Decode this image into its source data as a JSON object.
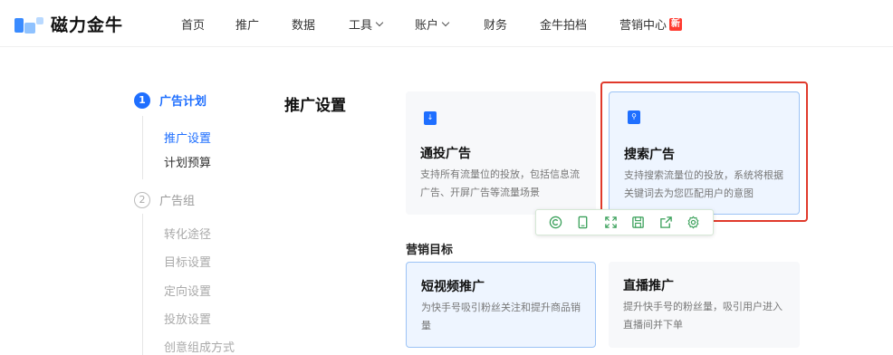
{
  "brand": {
    "name": "磁力金牛"
  },
  "nav": {
    "items": [
      {
        "label": "首页",
        "dropdown": false
      },
      {
        "label": "推广",
        "dropdown": false
      },
      {
        "label": "数据",
        "dropdown": false
      },
      {
        "label": "工具",
        "dropdown": true
      },
      {
        "label": "账户",
        "dropdown": true
      },
      {
        "label": "财务",
        "dropdown": false
      },
      {
        "label": "金牛拍档",
        "dropdown": false
      },
      {
        "label": "营销中心",
        "dropdown": false,
        "badge": "新"
      }
    ]
  },
  "steps": {
    "step1": {
      "num": "1",
      "title": "广告计划",
      "subs": [
        "推广设置",
        "计划预算"
      ]
    },
    "step2": {
      "num": "2",
      "title": "广告组",
      "subs": [
        "转化途径",
        "目标设置",
        "定向设置",
        "投放设置",
        "创意组成方式"
      ]
    }
  },
  "main": {
    "section_title": "推广设置",
    "cards": [
      {
        "title": "通投广告",
        "desc": "支持所有流量位的投放，包括信息流广告、开屏广告等流量场景",
        "icon": "download-icon",
        "selected": false
      },
      {
        "title": "搜索广告",
        "desc": "支持搜索流量位的投放，系统将根据关键词去为您匹配用户的意图",
        "icon": "search-doc-icon",
        "selected": true
      }
    ],
    "goal_title": "营销目标",
    "goal_cards": [
      {
        "title": "短视频推广",
        "desc": "为快手号吸引粉丝关注和提升商品销量",
        "selected": true
      },
      {
        "title": "直播推广",
        "desc": "提升快手号的粉丝量，吸引用户进入直播间并下单",
        "selected": false
      }
    ]
  },
  "toolbar": {
    "icons": [
      "copyright-icon",
      "phone-icon",
      "expand-icon",
      "save-icon",
      "share-icon",
      "settings-icon"
    ]
  },
  "colors": {
    "accent": "#1f6fff",
    "highlight": "#e0392b",
    "toolbar_icon": "#3aa05a",
    "badge": "#ff3b30"
  }
}
